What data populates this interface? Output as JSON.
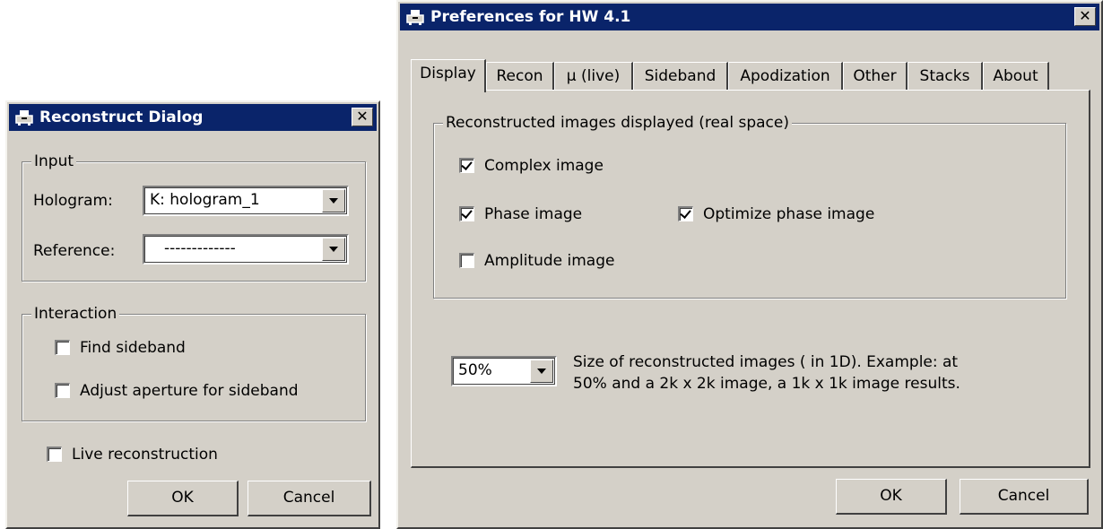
{
  "reconstruct": {
    "title": "Reconstruct Dialog",
    "close_glyph": "✕",
    "input_group": "Input",
    "hologram_label": "Hologram:",
    "hologram_value": "K: hologram_1",
    "reference_label": "Reference:",
    "reference_value": "-------------",
    "interaction_group": "Interaction",
    "find_sideband": {
      "label": "Find sideband",
      "checked": false
    },
    "adjust_aperture": {
      "label": "Adjust aperture for sideband",
      "checked": false
    },
    "live_reconstruction": {
      "label": "Live reconstruction",
      "checked": false
    },
    "ok_label": "OK",
    "cancel_label": "Cancel"
  },
  "preferences": {
    "title": "Preferences for HW 4.1",
    "close_glyph": "✕",
    "tabs": [
      "Display",
      "Recon",
      "µ (live)",
      "Sideband",
      "Apodization",
      "Other",
      "Stacks",
      "About"
    ],
    "active_tab": "Display",
    "group_title": "Reconstructed images displayed (real space)",
    "complex_image": {
      "label": "Complex image",
      "checked": true
    },
    "phase_image": {
      "label": "Phase image",
      "checked": true
    },
    "optimize_phase": {
      "label": "Optimize phase image",
      "checked": true
    },
    "amplitude_image": {
      "label": "Amplitude image",
      "checked": false
    },
    "size_value": "50%",
    "size_desc_line1": "Size of reconstructed images  ( in 1D).  Example: at",
    "size_desc_line2": "50% and a 2k x 2k image, a 1k x 1k image results.",
    "ok_label": "OK",
    "cancel_label": "Cancel"
  },
  "colors": {
    "face": "#d4d0c8",
    "titlebar": "#0a246a",
    "titletext": "#ffffff"
  },
  "icons": {
    "app": "printer-icon",
    "close": "close-icon",
    "dropdown": "chevron-down-icon",
    "check": "checkmark-icon"
  }
}
